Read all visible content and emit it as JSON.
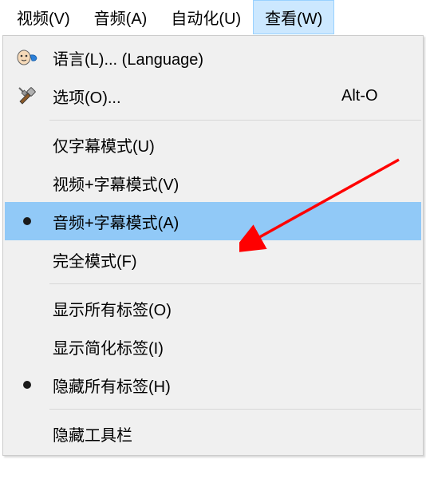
{
  "menubar": {
    "items": [
      {
        "label": "视频(V)"
      },
      {
        "label": "音频(A)"
      },
      {
        "label": "自动化(U)"
      },
      {
        "label": "查看(W)"
      }
    ],
    "activeIndex": 3
  },
  "dropdown": {
    "groups": [
      [
        {
          "icon": "language-icon",
          "label": "语言(L)... (Language)",
          "shortcut": ""
        },
        {
          "icon": "options-icon",
          "label": "选项(O)...",
          "shortcut": "Alt-O"
        }
      ],
      [
        {
          "icon": "",
          "label": "仅字幕模式(U)",
          "shortcut": ""
        },
        {
          "icon": "",
          "label": "视频+字幕模式(V)",
          "shortcut": ""
        },
        {
          "icon": "radio-dot",
          "label": "音频+字幕模式(A)",
          "shortcut": "",
          "highlighted": true
        },
        {
          "icon": "",
          "label": "完全模式(F)",
          "shortcut": ""
        }
      ],
      [
        {
          "icon": "",
          "label": "显示所有标签(O)",
          "shortcut": ""
        },
        {
          "icon": "",
          "label": "显示简化标签(I)",
          "shortcut": ""
        },
        {
          "icon": "radio-dot",
          "label": "隐藏所有标签(H)",
          "shortcut": ""
        }
      ],
      [
        {
          "icon": "",
          "label": "隐藏工具栏",
          "shortcut": ""
        }
      ]
    ]
  }
}
